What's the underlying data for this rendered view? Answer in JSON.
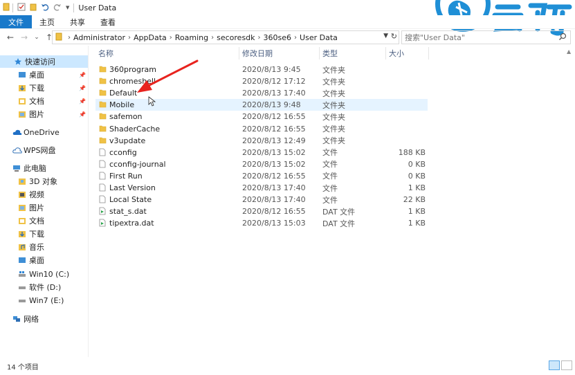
{
  "window": {
    "title": "User Data"
  },
  "ribbon": {
    "tabs": [
      "文件",
      "主页",
      "共享",
      "查看"
    ]
  },
  "address": {
    "crumbs": [
      "Administrator",
      "AppData",
      "Roaming",
      "secoresdk",
      "360se6",
      "User Data"
    ]
  },
  "search": {
    "placeholder": "搜索\"User Data\""
  },
  "sidebar": {
    "quick_access": "快速访问",
    "quick_items": [
      "桌面",
      "下载",
      "文档",
      "图片"
    ],
    "onedrive": "OneDrive",
    "wps": "WPS网盘",
    "this_pc": "此电脑",
    "pc_items": [
      "3D 对象",
      "视频",
      "图片",
      "文档",
      "下载",
      "音乐",
      "桌面",
      "Win10 (C:)",
      "软件 (D:)",
      "Win7 (E:)"
    ],
    "network": "网络"
  },
  "columns": {
    "name": "名称",
    "date": "修改日期",
    "type": "类型",
    "size": "大小"
  },
  "files": [
    {
      "name": "360program",
      "date": "2020/8/13 9:45",
      "type": "文件夹",
      "size": "",
      "icon": "folder-icon"
    },
    {
      "name": "chromeshell",
      "date": "2020/8/12 17:12",
      "type": "文件夹",
      "size": "",
      "icon": "folder-icon"
    },
    {
      "name": "Default",
      "date": "2020/8/13 17:40",
      "type": "文件夹",
      "size": "",
      "icon": "folder-icon"
    },
    {
      "name": "Mobile",
      "date": "2020/8/13 9:48",
      "type": "文件夹",
      "size": "",
      "icon": "folder-icon"
    },
    {
      "name": "safemon",
      "date": "2020/8/12 16:55",
      "type": "文件夹",
      "size": "",
      "icon": "folder-icon"
    },
    {
      "name": "ShaderCache",
      "date": "2020/8/12 16:55",
      "type": "文件夹",
      "size": "",
      "icon": "folder-icon"
    },
    {
      "name": "v3update",
      "date": "2020/8/13 12:49",
      "type": "文件夹",
      "size": "",
      "icon": "folder-icon"
    },
    {
      "name": "cconfig",
      "date": "2020/8/13 15:02",
      "type": "文件",
      "size": "188 KB",
      "icon": "file-icon"
    },
    {
      "name": "cconfig-journal",
      "date": "2020/8/13 15:02",
      "type": "文件",
      "size": "0 KB",
      "icon": "file-icon"
    },
    {
      "name": "First Run",
      "date": "2020/8/12 16:55",
      "type": "文件",
      "size": "0 KB",
      "icon": "file-icon"
    },
    {
      "name": "Last Version",
      "date": "2020/8/13 17:40",
      "type": "文件",
      "size": "1 KB",
      "icon": "file-icon"
    },
    {
      "name": "Local State",
      "date": "2020/8/13 17:40",
      "type": "文件",
      "size": "22 KB",
      "icon": "file-icon"
    },
    {
      "name": "stat_s.dat",
      "date": "2020/8/12 16:55",
      "type": "DAT 文件",
      "size": "1 KB",
      "icon": "dat-file-icon"
    },
    {
      "name": "tipextra.dat",
      "date": "2020/8/13 15:03",
      "type": "DAT 文件",
      "size": "1 KB",
      "icon": "dat-file-icon"
    }
  ],
  "hovered_row": "Mobile",
  "annotation": {
    "points_to": "Default",
    "color": "#e8231e"
  },
  "status": {
    "count": "14 个项目"
  },
  "colors": {
    "accent": "#1979ca",
    "folder": "#f0c246",
    "selection": "#cce8ff",
    "hover": "#e5f3ff"
  },
  "watermark": {
    "brand": "云骑"
  }
}
